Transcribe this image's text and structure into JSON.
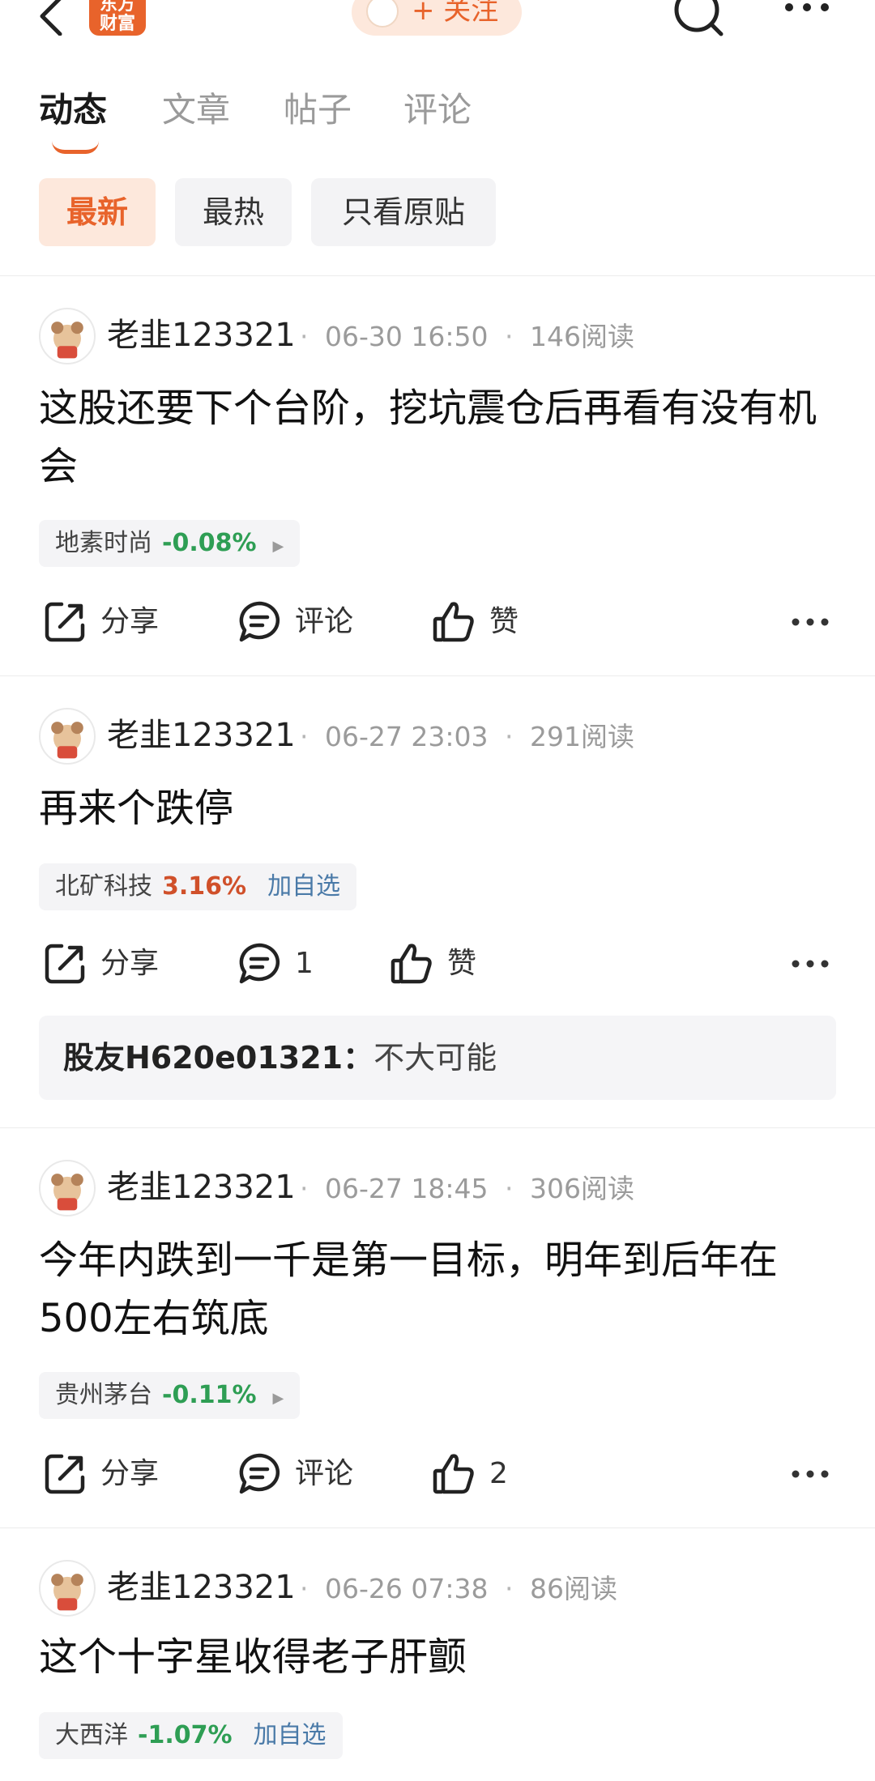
{
  "header": {
    "logo_text": "东方\n财富",
    "follow_label": "+ 关注",
    "icons": [
      "back-icon",
      "search-icon",
      "more-icon"
    ]
  },
  "tabs": [
    {
      "label": "动态",
      "active": true
    },
    {
      "label": "文章",
      "active": false
    },
    {
      "label": "帖子",
      "active": false
    },
    {
      "label": "评论",
      "active": false
    }
  ],
  "filters": [
    {
      "label": "最新",
      "active": true
    },
    {
      "label": "最热",
      "active": false
    },
    {
      "label": "只看原贴",
      "active": false
    }
  ],
  "colors": {
    "accent": "#e8632b",
    "up": "#d0502a",
    "down": "#2e9e54",
    "link": "#4a7aa8"
  },
  "posts": [
    {
      "username": "老韭123321",
      "time": "06-30 16:50",
      "reads": "146阅读",
      "content": "这股还要下个台阶，挖坑震仓后再看有没有机会",
      "stock": {
        "name": "地素时尚",
        "change": "-0.08%",
        "direction": "down"
      },
      "share_label": "分享",
      "comment_label": "评论",
      "like_label": "赞"
    },
    {
      "username": "老韭123321",
      "time": "06-27 23:03",
      "reads": "291阅读",
      "content": "再来个跌停",
      "stock": {
        "name": "北矿科技",
        "change": "3.16%",
        "direction": "up",
        "add_watch": "加自选"
      },
      "share_label": "分享",
      "comment_label": "1",
      "like_label": "赞",
      "reply": {
        "name": "股友H620e01321",
        "sep": "：",
        "text": "不大可能"
      }
    },
    {
      "username": "老韭123321",
      "time": "06-27 18:45",
      "reads": "306阅读",
      "content": "今年内跌到一千是第一目标，明年到后年在500左右筑底",
      "stock": {
        "name": "贵州茅台",
        "change": "-0.11%",
        "direction": "down"
      },
      "share_label": "分享",
      "comment_label": "评论",
      "like_label": "2"
    },
    {
      "username": "老韭123321",
      "time": "06-26 07:38",
      "reads": "86阅读",
      "content": "这个十字星收得老子肝颤",
      "stock": {
        "name": "大西洋",
        "change": "-1.07%",
        "direction": "down",
        "add_watch": "加自选"
      }
    }
  ],
  "separator": "·"
}
